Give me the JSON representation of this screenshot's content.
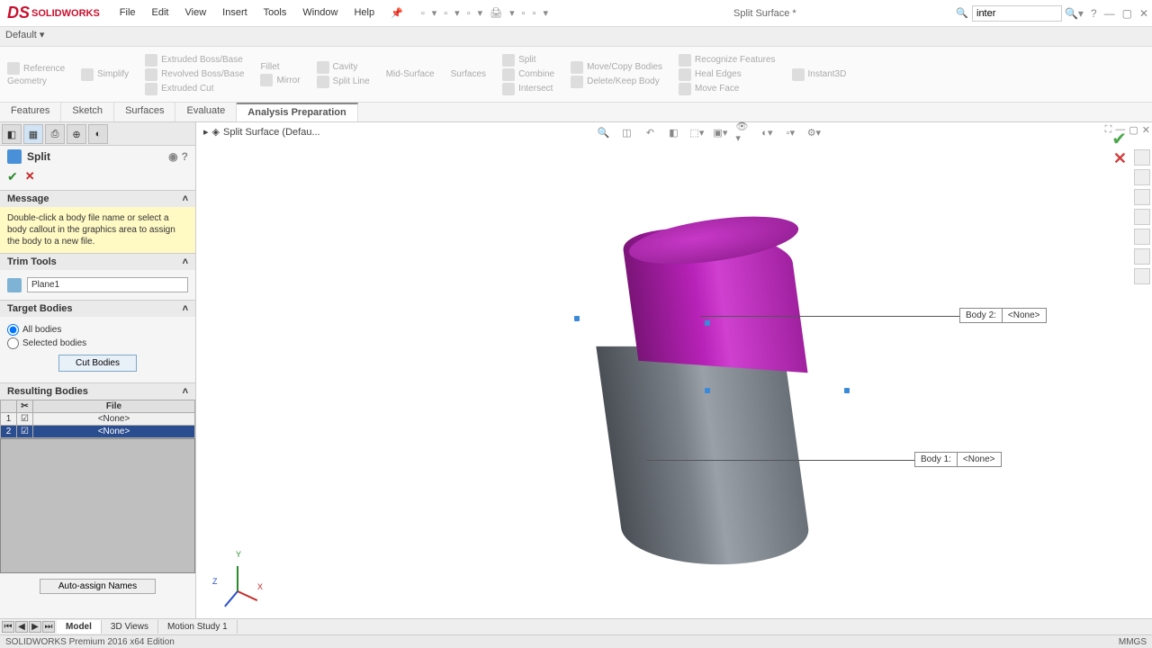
{
  "logo": "SOLIDWORKS",
  "menu": [
    "File",
    "Edit",
    "View",
    "Insert",
    "Tools",
    "Window",
    "Help"
  ],
  "doc_title": "Split Surface *",
  "search_value": "inter",
  "default_label": "Default",
  "ribbon": {
    "g1": {
      "a": "Reference",
      "b": "Geometry",
      "c": "Simplify"
    },
    "g2": {
      "a": "Extruded Boss/Base",
      "b": "Revolved Boss/Base",
      "c": "Extruded Cut"
    },
    "g3": {
      "a": "Fillet",
      "b": "Mirror"
    },
    "g4": {
      "a": "Cavity",
      "b": "Split Line"
    },
    "g5": {
      "a": "Mid-Surface",
      "b": "Surfaces"
    },
    "g6": {
      "a": "Split",
      "b": "Combine",
      "c": "Intersect"
    },
    "g7": {
      "a": "Move/Copy Bodies",
      "b": "Delete/Keep Body"
    },
    "g8": {
      "a": "Recognize Features",
      "b": "Heal Edges",
      "c": "Move Face"
    },
    "g9": {
      "a": "Instant3D"
    }
  },
  "tabs": [
    "Features",
    "Sketch",
    "Surfaces",
    "Evaluate",
    "Analysis Preparation"
  ],
  "active_tab": "Analysis Preparation",
  "breadcrumb": "Split Surface (Defau...",
  "prop": {
    "title": "Split",
    "message_hdr": "Message",
    "message": "Double-click a body file name or select a body callout in the graphics area to assign the body to a new file.",
    "trim_hdr": "Trim Tools",
    "trim_value": "Plane1",
    "target_hdr": "Target Bodies",
    "target_all": "All bodies",
    "target_sel": "Selected bodies",
    "cut_btn": "Cut Bodies",
    "result_hdr": "Resulting Bodies",
    "col_file": "File",
    "row1_file": "<None>",
    "row2_file": "<None>",
    "auto_assign": "Auto-assign Names"
  },
  "callouts": {
    "b1_label": "Body  1:",
    "b1_val": "<None>",
    "b2_label": "Body  2:",
    "b2_val": "<None>"
  },
  "triad": {
    "x": "X",
    "y": "Y",
    "z": "Z"
  },
  "bottom_tabs": [
    "Model",
    "3D Views",
    "Motion Study 1"
  ],
  "status_left": "SOLIDWORKS Premium 2016 x64 Edition",
  "status_right": "MMGS"
}
